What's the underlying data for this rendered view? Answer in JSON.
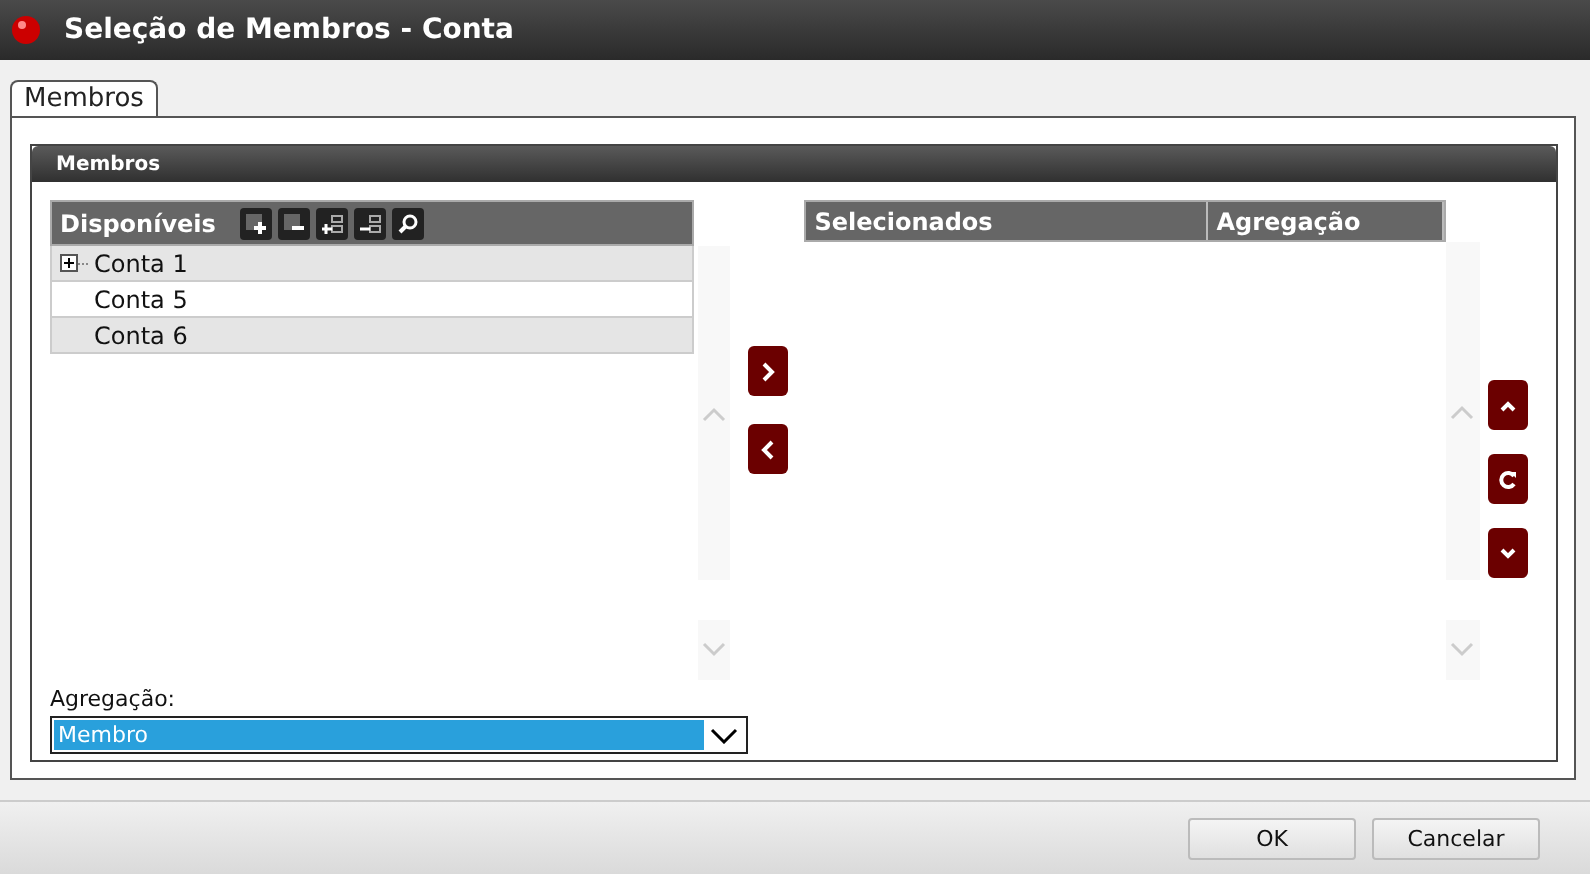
{
  "window": {
    "title": "Seleção de Membros - Conta"
  },
  "tabs": [
    {
      "label": "Membros",
      "selected": true
    }
  ],
  "group": {
    "title": "Membros"
  },
  "available": {
    "header": "Disponíveis",
    "rows": [
      {
        "kind": "group",
        "label": "Conta 1",
        "expanded": false
      },
      {
        "kind": "leaf",
        "label": "Conta 5"
      },
      {
        "kind": "leaf",
        "label": "Conta 6"
      }
    ]
  },
  "selected_table": {
    "columns": [
      "Selecionados",
      "Agregação"
    ]
  },
  "aggregation": {
    "label": "Agregação:",
    "value": "Membro"
  },
  "buttons": [
    "OK",
    "Cancelar"
  ]
}
